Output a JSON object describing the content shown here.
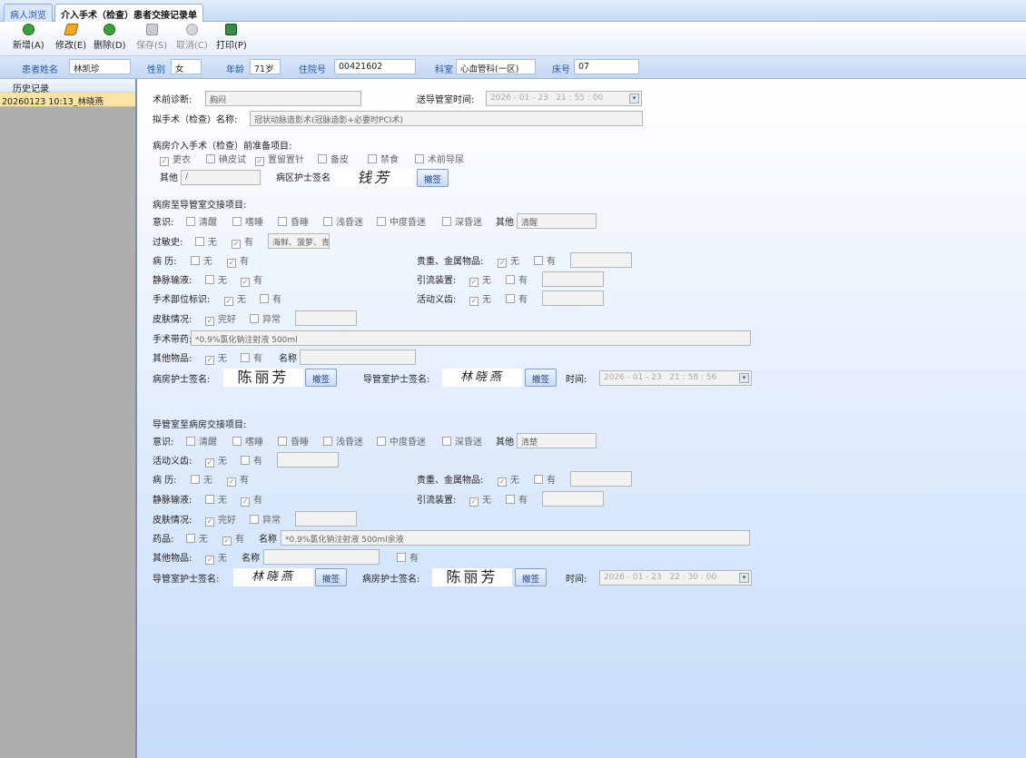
{
  "tabs": [
    "病人浏览",
    "介入手术（检查）患者交接记录单"
  ],
  "toolbar": {
    "new": "新增(A)",
    "edit": "修改(E)",
    "delete": "删除(D)",
    "save": "保存(S)",
    "cancel": "取消(C)",
    "print": "打印(P)"
  },
  "patient": {
    "name_label": "患者姓名",
    "name": "林凯珍",
    "sex_label": "性别",
    "sex": "女",
    "age_label": "年龄",
    "age": "71岁",
    "admission_label": "住院号",
    "admission": "00421602",
    "dept_label": "科室",
    "dept": "心血管科(一区)",
    "bed_label": "床号",
    "bed": "07"
  },
  "sidebar": {
    "header": "历史记录",
    "record": "20260123 10:13_林晓燕"
  },
  "form": {
    "diag_label": "术前诊断:",
    "diag": "胸闷",
    "send_time_label": "送导管室时间:",
    "send_time": "2026 - 01 - 23   21 : 55 : 00",
    "op_name_label": "拟手术（检查）名称:",
    "op_name": "冠状动脉造影术(冠脉造影+必要时PCI术)",
    "prep_title": "病房介入手术（检查）前准备项目:",
    "prep_items": [
      "更衣",
      "碘皮试",
      "置留置针",
      "备皮",
      "禁食",
      "术前导尿"
    ],
    "prep_checked": [
      true,
      false,
      true,
      false,
      false,
      false
    ],
    "prep_other_label": "其他",
    "prep_other": "/",
    "ward_nurse_sig_label": "病区护士签名",
    "ward_nurse_sig": "钱芳",
    "withdraw": "撤签",
    "s1_title": "病房至导管室交接项目:",
    "consc_label": "意识:",
    "consc_items": [
      "清醒",
      "嗜睡",
      "昏睡",
      "浅昏迷",
      "中度昏迷",
      "深昏迷"
    ],
    "other_label": "其他",
    "consc_other": "清醒",
    "allergy_label": "过敏史:",
    "none": "无",
    "yes": "有",
    "allergy_text": "海鲜、菠萝、青霉素",
    "history_label": "病  历:",
    "valuables_label": "贵重、金属物品:",
    "iv_label": "静脉输液:",
    "drain_label": "引流装置:",
    "site_label": "手术部位标识:",
    "denture_label": "活动义齿:",
    "skin_label": "皮肤情况:",
    "skin_ok": "完好",
    "skin_bad": "异常",
    "drug_label": "手术带药:",
    "drug_text": "*0.9%氯化钠注射液 500ml",
    "other_items_label": "其他物品:",
    "name_label": "名称",
    "ward_sig_label": "病房护士签名:",
    "ward_sig": "陈丽芳",
    "cath_sig_label": "导管室护士签名:",
    "cath_sig": "林晓燕",
    "time_label": "时间:",
    "time1": "2026 - 01 - 23   21 : 58 : 56",
    "s2_title": "导管室至病房交接项目:",
    "consc_other2": "清楚",
    "drug2_label": "药品:",
    "drug2_text": "*0.9%氯化钠注射液 500ml余液",
    "time2": "2026 - 01 - 23   22 : 30 : 00"
  }
}
